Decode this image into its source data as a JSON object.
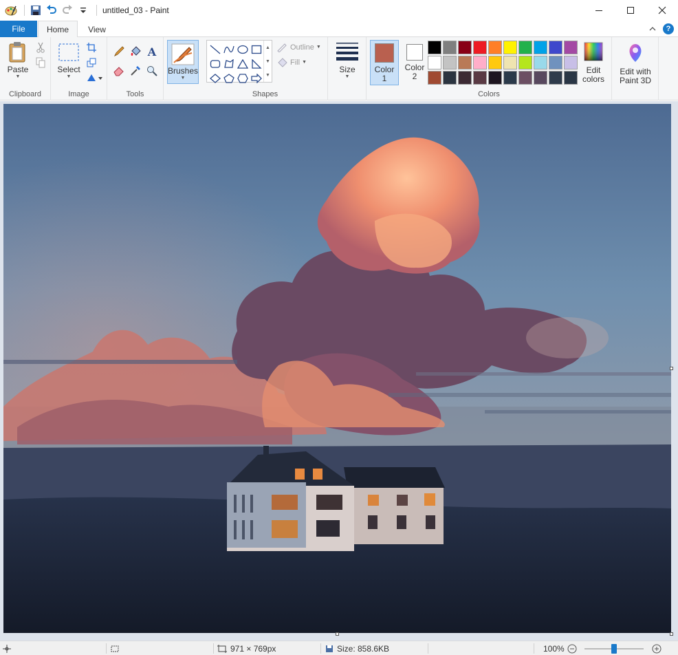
{
  "titlebar": {
    "title": "untitled_03 - Paint",
    "qat_icons": [
      "paint-app-icon",
      "save-icon",
      "undo-icon",
      "redo-icon",
      "customize-qat-icon"
    ]
  },
  "tabs": {
    "file": "File",
    "home": "Home",
    "view": "View"
  },
  "ribbon": {
    "clipboard": {
      "label": "Clipboard",
      "paste": "Paste"
    },
    "image": {
      "label": "Image",
      "select": "Select"
    },
    "tools": {
      "label": "Tools"
    },
    "brushes": {
      "label": "Brushes"
    },
    "shapes": {
      "label": "Shapes",
      "outline": "Outline",
      "fill": "Fill"
    },
    "size": {
      "label": "Size"
    },
    "colors": {
      "label": "Colors",
      "color1_line1": "Color",
      "color1_line2": "1",
      "color2_line1": "Color",
      "color2_line2": "2",
      "color1_value": "#b9604f",
      "color2_value": "#ffffff",
      "edit_line1": "Edit",
      "edit_line2": "colors",
      "palette": [
        "#000000",
        "#7f7f7f",
        "#880015",
        "#ed1c24",
        "#ff7f27",
        "#fff200",
        "#22b14c",
        "#00a2e8",
        "#3f48cc",
        "#a349a4",
        "#ffffff",
        "#c3c3c3",
        "#b97a57",
        "#ffaec9",
        "#ffc90e",
        "#efe4b0",
        "#b5e61d",
        "#99d9ea",
        "#7092be",
        "#c8bfe7",
        "#a04a32",
        "#2b3440",
        "#3c2a33",
        "#5a3a44",
        "#1e1620",
        "#2b3a4a",
        "#6c4f63",
        "#58485e",
        "#2f3b4b",
        "#2a3645"
      ]
    },
    "paint3d": {
      "line1": "Edit with",
      "line2": "Paint 3D"
    }
  },
  "statusbar": {
    "dimensions": "971 × 769px",
    "size": "Size: 858.6KB",
    "zoom": "100%",
    "zoom_level": 1.0
  }
}
